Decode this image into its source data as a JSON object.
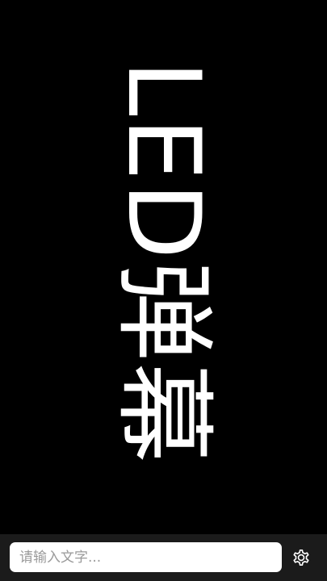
{
  "marquee": {
    "text": "LED弹幕",
    "text_color": "#ffffff",
    "background_color": "#000000"
  },
  "input_bar": {
    "placeholder": "请输入文字...",
    "value": "",
    "background_color": "#1b1b1b"
  },
  "settings": {
    "icon": "gear-icon"
  }
}
